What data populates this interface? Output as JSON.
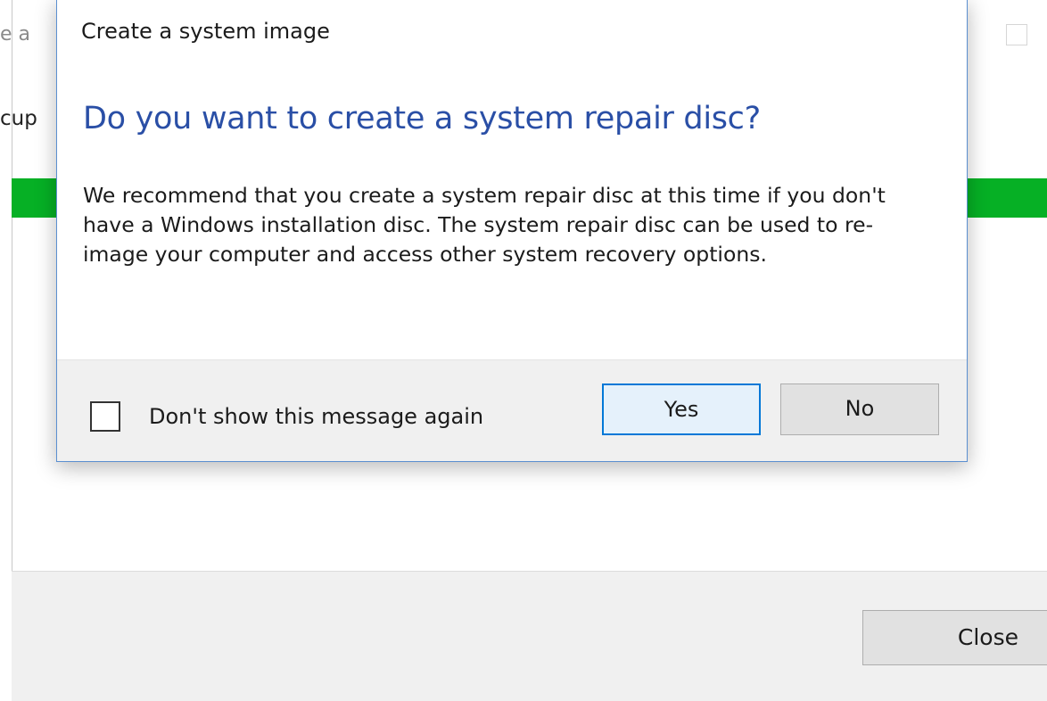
{
  "background_window": {
    "partial_text_top": "e a",
    "partial_text_mid": "cup",
    "progress_color": "#06b025",
    "close_label": "Close"
  },
  "dialog": {
    "title": "Create a system image",
    "heading": "Do you want to create a system repair disc?",
    "body": "We recommend that you create a system repair disc at this time if you don't have a Windows installation disc. The system repair disc can be used to re-image your computer and access other system recovery options.",
    "checkbox_label": "Don't show this message again",
    "checkbox_checked": false,
    "yes_label": "Yes",
    "no_label": "No",
    "heading_color": "#2a4fa6",
    "accent_color": "#0078d7"
  }
}
